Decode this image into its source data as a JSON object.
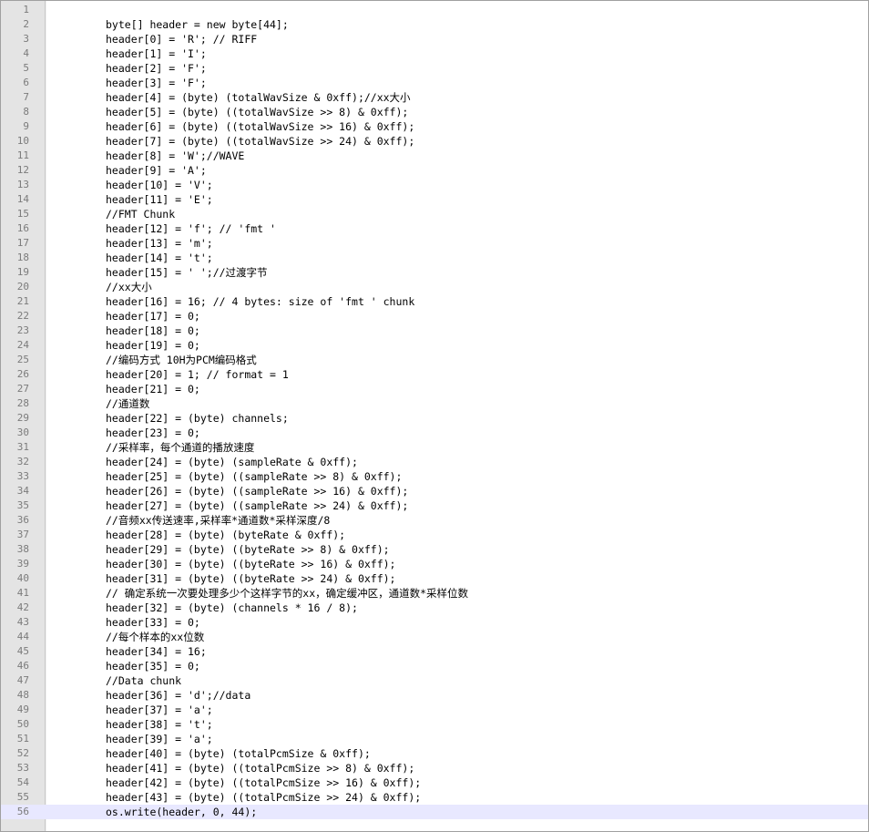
{
  "editor": {
    "current_line": 56,
    "lines": [
      "",
      "byte[] header = new byte[44];",
      "header[0] = 'R'; // RIFF",
      "header[1] = 'I';",
      "header[2] = 'F';",
      "header[3] = 'F';",
      "header[4] = (byte) (totalWavSize & 0xff);//xx大小",
      "header[5] = (byte) ((totalWavSize >> 8) & 0xff);",
      "header[6] = (byte) ((totalWavSize >> 16) & 0xff);",
      "header[7] = (byte) ((totalWavSize >> 24) & 0xff);",
      "header[8] = 'W';//WAVE",
      "header[9] = 'A';",
      "header[10] = 'V';",
      "header[11] = 'E';",
      "//FMT Chunk",
      "header[12] = 'f'; // 'fmt '",
      "header[13] = 'm';",
      "header[14] = 't';",
      "header[15] = ' ';//过渡字节",
      "//xx大小",
      "header[16] = 16; // 4 bytes: size of 'fmt ' chunk",
      "header[17] = 0;",
      "header[18] = 0;",
      "header[19] = 0;",
      "//编码方式 10H为PCM编码格式",
      "header[20] = 1; // format = 1",
      "header[21] = 0;",
      "//通道数",
      "header[22] = (byte) channels;",
      "header[23] = 0;",
      "//采样率，每个通道的播放速度",
      "header[24] = (byte) (sampleRate & 0xff);",
      "header[25] = (byte) ((sampleRate >> 8) & 0xff);",
      "header[26] = (byte) ((sampleRate >> 16) & 0xff);",
      "header[27] = (byte) ((sampleRate >> 24) & 0xff);",
      "//音频xx传送速率,采样率*通道数*采样深度/8",
      "header[28] = (byte) (byteRate & 0xff);",
      "header[29] = (byte) ((byteRate >> 8) & 0xff);",
      "header[30] = (byte) ((byteRate >> 16) & 0xff);",
      "header[31] = (byte) ((byteRate >> 24) & 0xff);",
      "// 确定系统一次要处理多少个这样字节的xx，确定缓冲区，通道数*采样位数",
      "header[32] = (byte) (channels * 16 / 8);",
      "header[33] = 0;",
      "//每个样本的xx位数",
      "header[34] = 16;",
      "header[35] = 0;",
      "//Data chunk",
      "header[36] = 'd';//data",
      "header[37] = 'a';",
      "header[38] = 't';",
      "header[39] = 'a';",
      "header[40] = (byte) (totalPcmSize & 0xff);",
      "header[41] = (byte) ((totalPcmSize >> 8) & 0xff);",
      "header[42] = (byte) ((totalPcmSize >> 16) & 0xff);",
      "header[43] = (byte) ((totalPcmSize >> 24) & 0xff);",
      "os.write(header, 0, 44);"
    ]
  }
}
